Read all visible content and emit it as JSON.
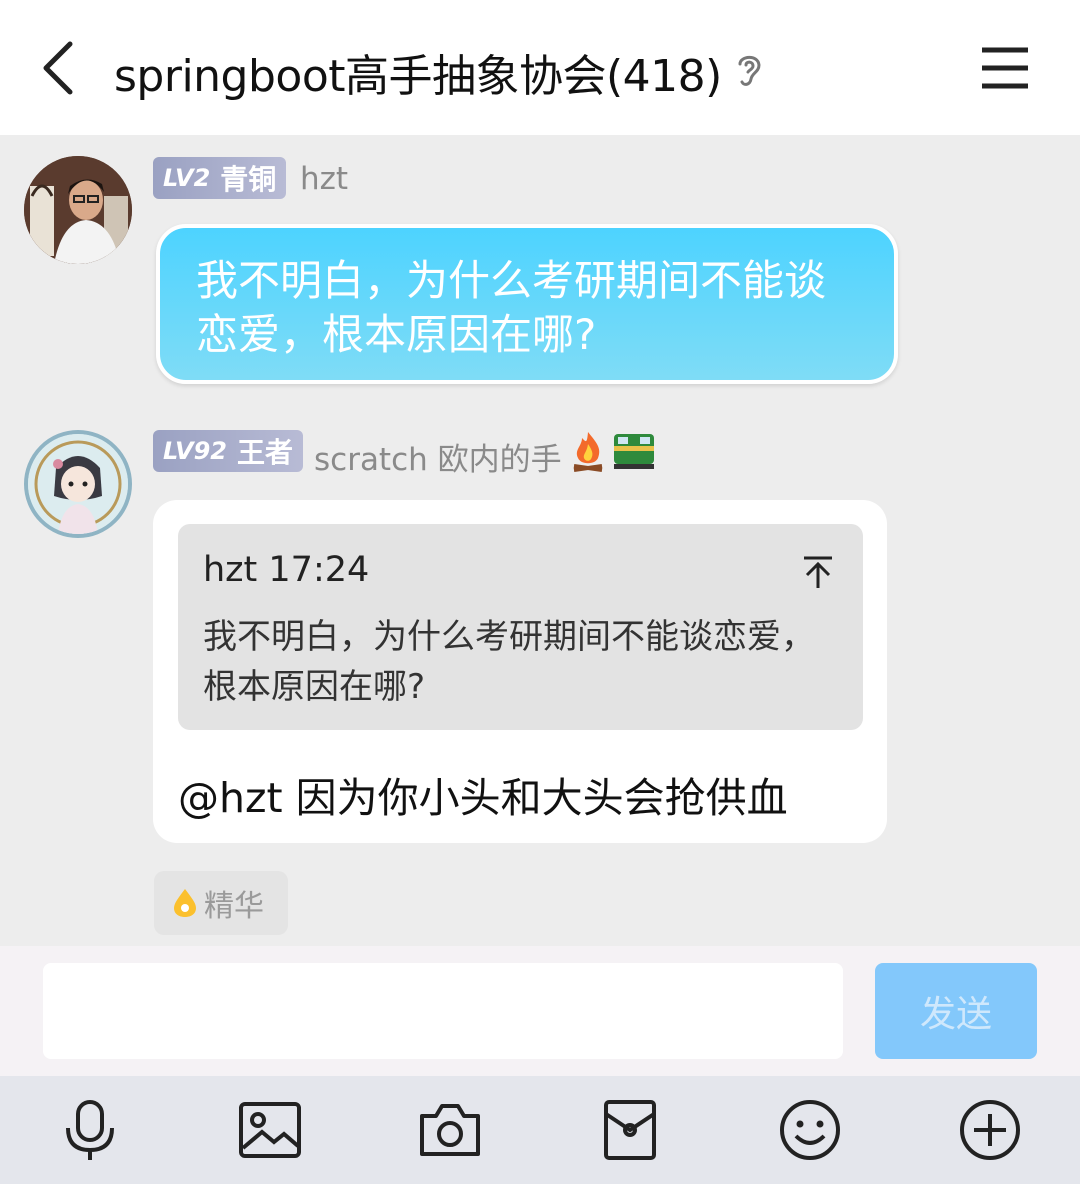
{
  "header": {
    "title": "springboot高手抽象协会(418)",
    "back_icon": "chevron-left-icon",
    "ear_icon": "ear-icon",
    "menu_icon": "hamburger-menu-icon"
  },
  "messages": [
    {
      "level": "LV2",
      "rank": "青铜",
      "sender": "hzt",
      "text": "我不明白，为什么考研期间不能谈恋爱，根本原因在哪?"
    },
    {
      "level": "LV92",
      "rank": "王者",
      "sender": "scratch 欧内的手",
      "tags": [
        "🔥",
        "🚂"
      ],
      "quote": {
        "author_time": "hzt 17:24",
        "text": "我不明白，为什么考研期间不能谈恋爱，根本原因在哪?"
      },
      "text": "@hzt 因为你小头和大头会抢供血"
    }
  ],
  "essence_tag": "精华",
  "input": {
    "value": "",
    "send_label": "发送"
  },
  "toolbar": [
    "microphone-icon",
    "image-icon",
    "camera-icon",
    "red-packet-icon",
    "emoji-icon",
    "plus-icon"
  ],
  "colors": {
    "bubble_blue": "#4dd3ff",
    "send_button": "#83c8fb",
    "level_badge": "#9aa1c2"
  }
}
